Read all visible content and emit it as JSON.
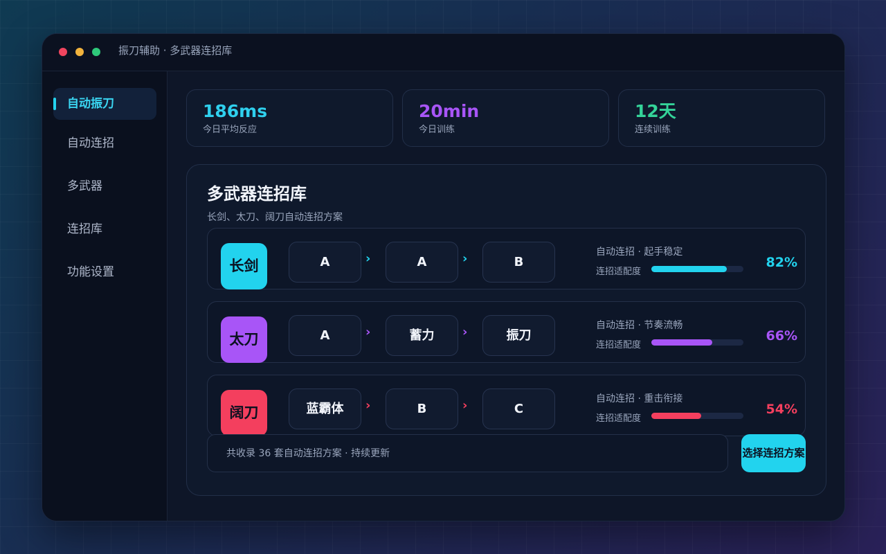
{
  "window": {
    "title": "振刀辅助 · 多武器连招库"
  },
  "sidebar": {
    "items": [
      {
        "label": "自动振刀",
        "active": true
      },
      {
        "label": "自动连招",
        "active": false
      },
      {
        "label": "多武器",
        "active": false
      },
      {
        "label": "连招库",
        "active": false
      },
      {
        "label": "功能设置",
        "active": false
      }
    ]
  },
  "stats": [
    {
      "value": "186ms",
      "label": "今日平均反应",
      "color": "#2fd0ee"
    },
    {
      "value": "20min",
      "label": "今日训练",
      "color": "#a855f7"
    },
    {
      "value": "12天",
      "label": "连续训练",
      "color": "#34d399"
    }
  ],
  "panel": {
    "title": "多武器连招库",
    "subtitle": "长剑、太刀、阔刀自动连招方案",
    "rows": [
      {
        "weapon": "长剑",
        "color": "#22d3ee",
        "combo": [
          "A",
          "A",
          "B"
        ],
        "arrow": "›",
        "desc": "自动连招 · 起手稳定",
        "label": "连招适配度",
        "percent_text": "82%",
        "percent": 82
      },
      {
        "weapon": "太刀",
        "color": "#a855f7",
        "combo": [
          "A",
          "蓄力",
          "振刀"
        ],
        "arrow": "›",
        "desc": "自动连招 · 节奏流畅",
        "label": "连招适配度",
        "percent_text": "66%",
        "percent": 66
      },
      {
        "weapon": "阔刀",
        "color": "#f43f5e",
        "combo": [
          "蓝霸体",
          "B",
          "C"
        ],
        "arrow": "›",
        "desc": "自动连招 · 重击衔接",
        "label": "连招适配度",
        "percent_text": "54%",
        "percent": 54
      }
    ],
    "footer_text": "共收录 36 套自动连招方案 · 持续更新",
    "cta_label": "选择连招方案"
  }
}
